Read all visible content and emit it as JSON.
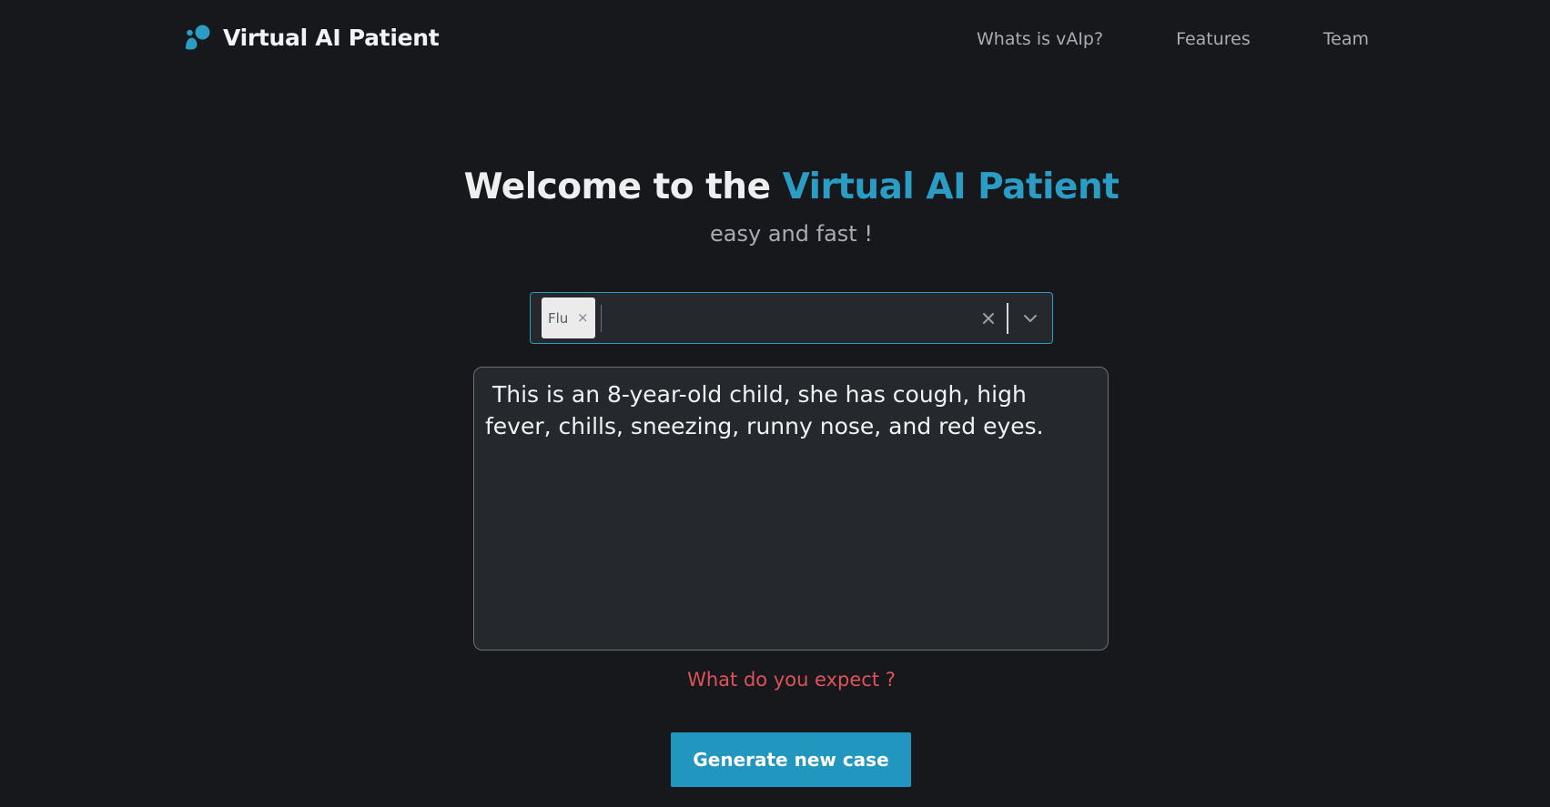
{
  "header": {
    "brand_name": "Virtual AI Patient",
    "brand_color": "#2b9cc3",
    "nav": [
      {
        "label": "Whats is vAIp?"
      },
      {
        "label": "Features"
      },
      {
        "label": "Team"
      }
    ]
  },
  "hero": {
    "title_prefix": "Welcome to the ",
    "title_accent": "Virtual AI Patient",
    "subtitle": "easy and fast !"
  },
  "select": {
    "selected": [
      {
        "label": "Flu"
      }
    ],
    "remove_icon": "×",
    "clear_icon": "close-icon",
    "dropdown_icon": "chevron-down-icon"
  },
  "case": {
    "text": " This is an 8-year-old child, she has cough, high fever, chills, sneezing, runny nose, and red eyes."
  },
  "expect_link": "What do you expect ?",
  "generate_button": "Generate new case",
  "colors": {
    "background": "#17181b",
    "accent": "#2b9cc3",
    "button": "#2196bf",
    "warning_text": "#e0525a"
  }
}
